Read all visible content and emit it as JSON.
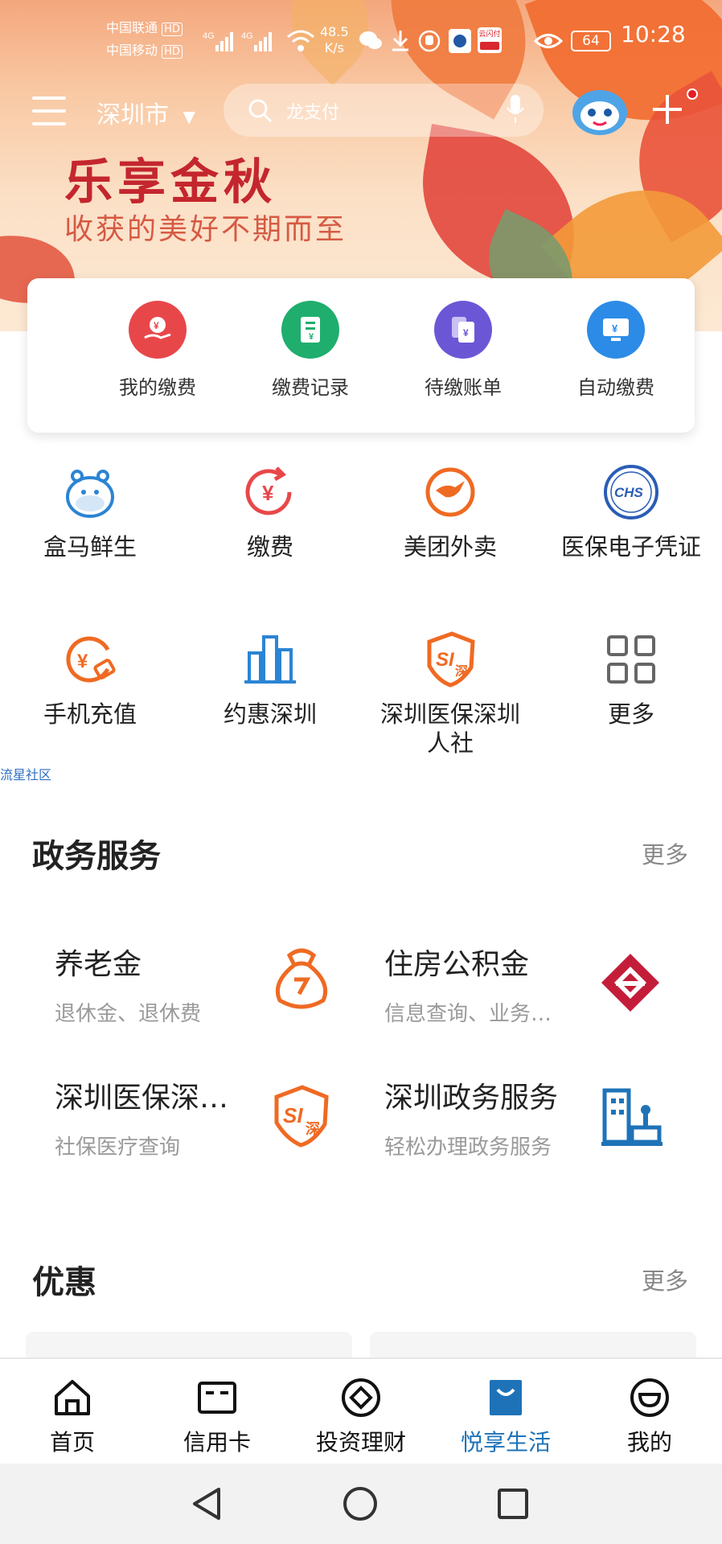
{
  "status_bar": {
    "carrier1": "中国联通",
    "carrier2": "中国移动",
    "hd1": "HD",
    "hd2": "HD",
    "net1": "4G",
    "net2": "4G",
    "speed_value": "48.5",
    "speed_unit": "K/s",
    "battery": "64",
    "time": "10:28",
    "pay_badge": "云闪付"
  },
  "header": {
    "city": "深圳市",
    "search_placeholder": "龙支付",
    "icons": [
      "menu-icon",
      "search-icon",
      "microphone-icon",
      "mascot-avatar",
      "plus-icon"
    ]
  },
  "banner": {
    "title": "乐享金秋",
    "subtitle": "收获的美好不期而至"
  },
  "quick_actions": [
    {
      "label": "我的缴费",
      "color": "#e8474a",
      "icon": "payment-hand-icon"
    },
    {
      "label": "缴费记录",
      "color": "#1fae6d",
      "icon": "receipt-record-icon"
    },
    {
      "label": "待缴账单",
      "color": "#6b57d6",
      "icon": "pending-bill-icon"
    },
    {
      "label": "自动缴费",
      "color": "#2c8be6",
      "icon": "auto-pay-monitor-icon"
    }
  ],
  "services_grid": [
    {
      "label": "盒马鲜生",
      "icon": "hippo-icon"
    },
    {
      "label": "缴费",
      "icon": "yuan-refresh-icon"
    },
    {
      "label": "美团外卖",
      "icon": "kangaroo-icon"
    },
    {
      "label": "医保电子凭证",
      "icon": "chs-badge-icon",
      "badge": "CHS"
    },
    {
      "label": "手机充值",
      "icon": "phone-recharge-icon"
    },
    {
      "label": "约惠深圳",
      "icon": "city-buildings-icon"
    },
    {
      "label": "深圳医保深圳人社",
      "icon": "si-shield-icon",
      "badge": "SI",
      "badge2": "深"
    },
    {
      "label": "更多",
      "icon": "more-grid-icon"
    }
  ],
  "community_link": "流星社区",
  "gov_section": {
    "title": "政务服务",
    "more": "更多",
    "items": [
      {
        "title": "养老金",
        "subtitle": "退休金、退休费",
        "icon": "money-bag-icon"
      },
      {
        "title": "住房公积金",
        "subtitle": "信息查询、业务办理",
        "icon": "housing-fund-icon"
      },
      {
        "title": "深圳医保深圳人社",
        "subtitle": "社保医疗查询",
        "icon": "si-shield-icon"
      },
      {
        "title": "深圳政务服务",
        "subtitle": "轻松办理政务服务",
        "icon": "gov-building-icon"
      }
    ]
  },
  "promo_section": {
    "title": "优惠",
    "more": "更多"
  },
  "tabbar": [
    {
      "label": "首页",
      "icon": "home-icon",
      "active": false
    },
    {
      "label": "信用卡",
      "icon": "credit-card-icon",
      "active": false
    },
    {
      "label": "投资理财",
      "icon": "invest-icon",
      "active": false
    },
    {
      "label": "悦享生活",
      "icon": "shopping-bag-icon",
      "active": true
    },
    {
      "label": "我的",
      "icon": "profile-icon",
      "active": false
    }
  ],
  "colors": {
    "accent_orange": "#ef6a23",
    "accent_blue": "#1e73b8",
    "banner_red": "#c4262e",
    "text_gray": "#9a9a9a"
  }
}
